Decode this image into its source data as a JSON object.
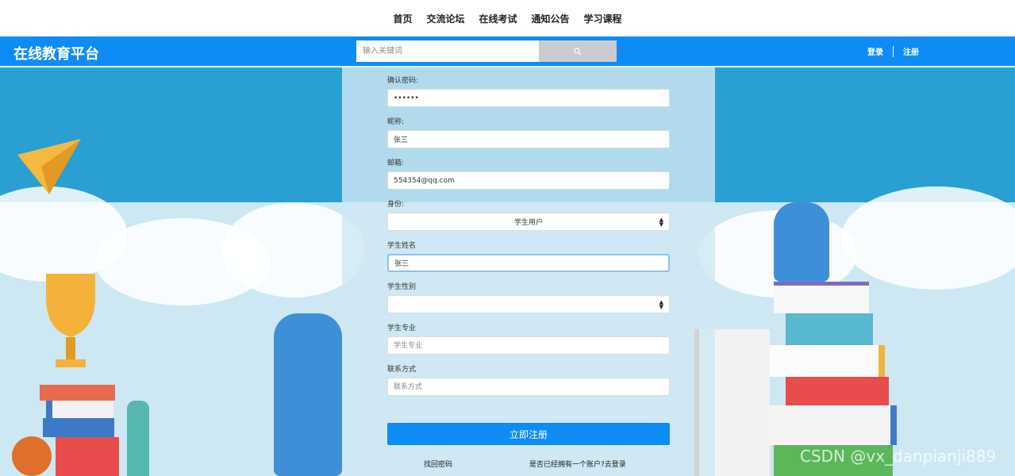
{
  "nav": {
    "items": [
      "首页",
      "交流论坛",
      "在线考试",
      "通知公告",
      "学习课程"
    ]
  },
  "header": {
    "brand": "在线教育平台",
    "search_placeholder": "输入关键词",
    "login": "登录",
    "register": "注册"
  },
  "form": {
    "confirm_password_label": "确认密码:",
    "confirm_password_value": "••••••",
    "nickname_label": "昵称:",
    "nickname_value": "张三",
    "email_label": "邮箱:",
    "email_value": "554354@qq.com",
    "identity_label": "身份:",
    "identity_value": "学生用户",
    "student_name_label": "学生姓名",
    "student_name_value": "张三",
    "student_gender_label": "学生性别",
    "student_gender_value": "",
    "student_major_label": "学生专业",
    "student_major_placeholder": "学生专业",
    "contact_label": "联系方式",
    "contact_placeholder": "联系方式",
    "submit_label": "立即注册",
    "forgot_password": "找回密码",
    "have_account": "是否已经拥有一个账户?去登录"
  },
  "watermark": "CSDN @vx_danpianji889",
  "colors": {
    "primary": "#0d8cf5",
    "background_sky": "#2a9fd1"
  }
}
